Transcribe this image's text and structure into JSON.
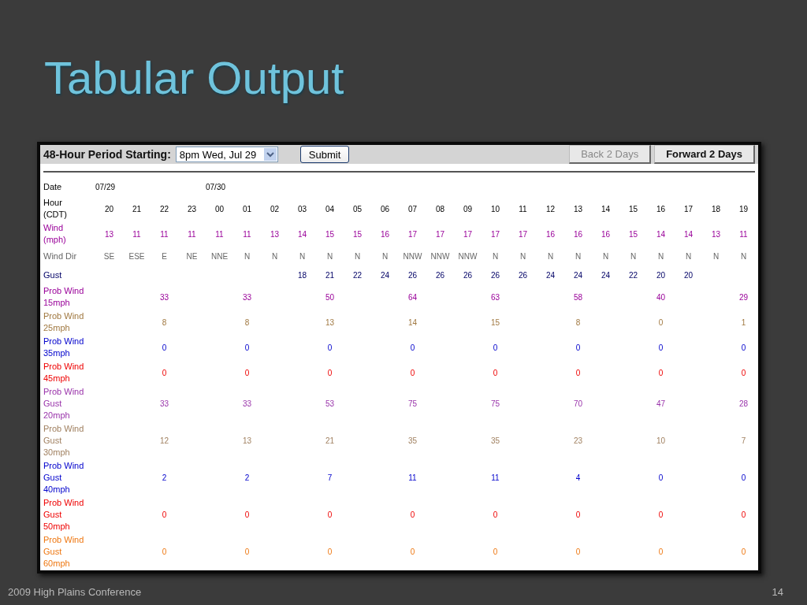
{
  "slide": {
    "title": "Tabular Output",
    "footer": "2009 High Plains Conference",
    "page_number": "14"
  },
  "form": {
    "label": "48-Hour Period Starting:",
    "select_value": "8pm Wed, Jul 29",
    "submit": "Submit",
    "nav_buttons": [
      {
        "label": "Back 2 Days",
        "disabled": true
      },
      {
        "label": "Forward 2 Days",
        "disabled": false
      }
    ]
  },
  "table": {
    "rows": [
      {
        "label": [
          "Date"
        ],
        "color": "#000000",
        "kind": "date",
        "cells": [
          "07/29",
          null,
          null,
          null,
          "07/30",
          null,
          null,
          null,
          null,
          null,
          null,
          null,
          null,
          null,
          null,
          null,
          null,
          null,
          null,
          null,
          null,
          null,
          null,
          null
        ]
      },
      {
        "label": [
          "Hour",
          "(CDT)"
        ],
        "color": "#000000",
        "kind": "plain",
        "cells": [
          "20",
          "21",
          "22",
          "23",
          "00",
          "01",
          "02",
          "03",
          "04",
          "05",
          "06",
          "07",
          "08",
          "09",
          "10",
          "11",
          "12",
          "13",
          "14",
          "15",
          "16",
          "17",
          "18",
          "19"
        ]
      },
      {
        "label": [
          "Wind",
          "(mph)"
        ],
        "color": "#990099",
        "kind": "plain",
        "cells": [
          "13",
          "11",
          "11",
          "11",
          "11",
          "11",
          "13",
          "14",
          "15",
          "15",
          "16",
          "17",
          "17",
          "17",
          "17",
          "17",
          "16",
          "16",
          "16",
          "15",
          "14",
          "14",
          "13",
          "11"
        ]
      },
      {
        "label": [
          "Wind Dir"
        ],
        "color": "#666666",
        "kind": "plain",
        "cells": [
          "SE",
          "ESE",
          "E",
          "NE",
          "NNE",
          "N",
          "N",
          "N",
          "N",
          "N",
          "N",
          "NNW",
          "NNW",
          "NNW",
          "N",
          "N",
          "N",
          "N",
          "N",
          "N",
          "N",
          "N",
          "N",
          "N"
        ]
      },
      {
        "label": [
          "Gust"
        ],
        "color": "#000066",
        "kind": "plain",
        "cells": [
          null,
          null,
          null,
          null,
          null,
          null,
          null,
          "18",
          "21",
          "22",
          "24",
          "26",
          "26",
          "26",
          "26",
          "26",
          "24",
          "24",
          "24",
          "22",
          "20",
          "20",
          null,
          null
        ]
      },
      {
        "label": [
          "Prob Wind",
          "15mph"
        ],
        "color": "#990099",
        "kind": "plain",
        "cells": [
          null,
          null,
          "33",
          null,
          null,
          "33",
          null,
          null,
          "50",
          null,
          null,
          "64",
          null,
          null,
          "63",
          null,
          null,
          "58",
          null,
          null,
          "40",
          null,
          null,
          "29"
        ]
      },
      {
        "label": [
          "Prob Wind",
          "25mph"
        ],
        "color": "#a07840",
        "kind": "plain",
        "cells": [
          null,
          null,
          "8",
          null,
          null,
          "8",
          null,
          null,
          "13",
          null,
          null,
          "14",
          null,
          null,
          "15",
          null,
          null,
          "8",
          null,
          null,
          "0",
          null,
          null,
          "1"
        ]
      },
      {
        "label": [
          "Prob Wind",
          "35mph"
        ],
        "color": "#0000cc",
        "kind": "plain",
        "cells": [
          null,
          null,
          "0",
          null,
          null,
          "0",
          null,
          null,
          "0",
          null,
          null,
          "0",
          null,
          null,
          "0",
          null,
          null,
          "0",
          null,
          null,
          "0",
          null,
          null,
          "0"
        ]
      },
      {
        "label": [
          "Prob Wind",
          "45mph"
        ],
        "color": "#ee0000",
        "kind": "plain",
        "cells": [
          null,
          null,
          "0",
          null,
          null,
          "0",
          null,
          null,
          "0",
          null,
          null,
          "0",
          null,
          null,
          "0",
          null,
          null,
          "0",
          null,
          null,
          "0",
          null,
          null,
          "0"
        ]
      },
      {
        "label": [
          "Prob Wind",
          "Gust",
          "20mph"
        ],
        "color": "#9933aa",
        "kind": "plain",
        "cells": [
          null,
          null,
          "33",
          null,
          null,
          "33",
          null,
          null,
          "53",
          null,
          null,
          "75",
          null,
          null,
          "75",
          null,
          null,
          "70",
          null,
          null,
          "47",
          null,
          null,
          "28"
        ]
      },
      {
        "label": [
          "Prob Wind",
          "Gust",
          "30mph"
        ],
        "color": "#a08060",
        "kind": "plain",
        "cells": [
          null,
          null,
          "12",
          null,
          null,
          "13",
          null,
          null,
          "21",
          null,
          null,
          "35",
          null,
          null,
          "35",
          null,
          null,
          "23",
          null,
          null,
          "10",
          null,
          null,
          "7"
        ]
      },
      {
        "label": [
          "Prob Wind",
          "Gust",
          "40mph"
        ],
        "color": "#0000cc",
        "kind": "plain",
        "cells": [
          null,
          null,
          "2",
          null,
          null,
          "2",
          null,
          null,
          "7",
          null,
          null,
          "11",
          null,
          null,
          "11",
          null,
          null,
          "4",
          null,
          null,
          "0",
          null,
          null,
          "0"
        ]
      },
      {
        "label": [
          "Prob Wind",
          "Gust",
          "50mph"
        ],
        "color": "#ee0000",
        "kind": "plain",
        "cells": [
          null,
          null,
          "0",
          null,
          null,
          "0",
          null,
          null,
          "0",
          null,
          null,
          "0",
          null,
          null,
          "0",
          null,
          null,
          "0",
          null,
          null,
          "0",
          null,
          null,
          "0"
        ]
      },
      {
        "label": [
          "Prob Wind",
          "Gust",
          "60mph"
        ],
        "color": "#ee7711",
        "kind": "plain",
        "cells": [
          null,
          null,
          "0",
          null,
          null,
          "0",
          null,
          null,
          "0",
          null,
          null,
          "0",
          null,
          null,
          "0",
          null,
          null,
          "0",
          null,
          null,
          "0",
          null,
          null,
          "0"
        ]
      }
    ]
  }
}
